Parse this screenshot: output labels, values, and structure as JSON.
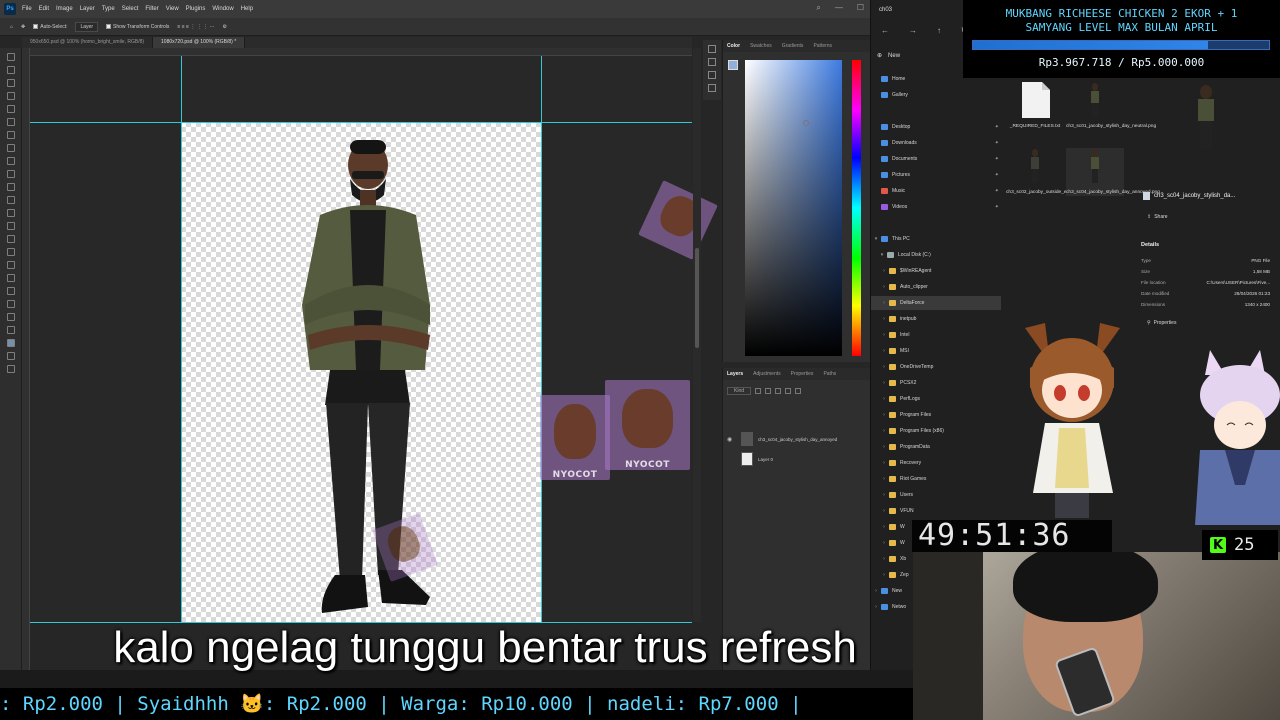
{
  "photoshop": {
    "logo": "Ps",
    "menu": [
      "File",
      "Edit",
      "Image",
      "Layer",
      "Type",
      "Select",
      "Filter",
      "View",
      "Plugins",
      "Window",
      "Help"
    ],
    "options": {
      "auto_select": "Auto-Select:",
      "layer_select": "Layer",
      "show_transform": "Show Transform Controls"
    },
    "doc_tabs": [
      {
        "label": "950x650.psd @ 100% (homo_bright_smile, RGB/8)",
        "active": false
      },
      {
        "label": "1080x720.psd @ 100% (RGB/8) *",
        "active": true
      }
    ],
    "color_panel": {
      "tabs": [
        "Color",
        "Swatches",
        "Gradients",
        "Patterns"
      ],
      "foreground": "#8fb0d8"
    },
    "layers_panel": {
      "tabs": [
        "Layers",
        "Adjustments",
        "Properties",
        "Paths"
      ],
      "filter": "Kind",
      "layers": [
        {
          "name": "ch3_sc04_jacoby_stylish_day_annoyed",
          "visible": true
        },
        {
          "name": "Layer 0",
          "visible": false
        }
      ]
    },
    "watermark_text": "NYOCOT"
  },
  "explorer": {
    "title": "ch03",
    "new_button": "New",
    "quick_access": [
      {
        "label": "Home",
        "pinned": false
      },
      {
        "label": "Gallery",
        "pinned": false
      },
      {
        "label": "Desktop",
        "pinned": true
      },
      {
        "label": "Downloads",
        "pinned": true
      },
      {
        "label": "Documents",
        "pinned": true
      },
      {
        "label": "Pictures",
        "pinned": true
      },
      {
        "label": "Music",
        "pinned": true
      },
      {
        "label": "Videos",
        "pinned": true
      }
    ],
    "this_pc": "This PC",
    "local_disk": "Local Disk (C:)",
    "folders": [
      "$WinREAgent",
      "Auto_clipper",
      "DeltaForce",
      "inetpub",
      "Intel",
      "MSI",
      "OneDriveTemp",
      "PCSX2",
      "PerfLogs",
      "Program Files",
      "Program Files (x86)",
      "ProgramData",
      "Recovery",
      "Riot Games",
      "Users",
      "VFUN",
      "W",
      "W",
      "Xb",
      "Zep"
    ],
    "network": [
      "New",
      "Netwo"
    ],
    "files": [
      {
        "name": "_REQUIRED_FILES.txt"
      },
      {
        "name": "ch3_sc01_jacoby_stylish_day_neutral.png"
      },
      {
        "name": "ch3_sc02_jacoby_outside_evening_grin.png"
      },
      {
        "name": "ch3_sc04_jacoby_stylish_day_annoyed.png"
      }
    ],
    "details": {
      "filename": "ch3_sc04_jacoby_stylish_da...",
      "share": "Share",
      "heading": "Details",
      "rows": [
        {
          "k": "Type",
          "v": "PNG File"
        },
        {
          "k": "Size",
          "v": "1,58 MB"
        },
        {
          "k": "File location",
          "v": "C:\\Users\\USER\\Pictures\\Five..."
        },
        {
          "k": "Date modified",
          "v": "28/04/2026 01:23"
        },
        {
          "k": "Dimensions",
          "v": "1340 x 2400"
        }
      ],
      "properties": "Properties"
    }
  },
  "overlay": {
    "donation_title": "MUKBANG RICHEESE CHICKEN 2 EKOR + 1\nSAMYANG LEVEL MAX BULAN APRIL",
    "donation_progress": 0.794,
    "donation_amount": "Rp3.967.718 / Rp5.000.000",
    "timer": "49:51:36",
    "kick_icon": "K",
    "viewer_count": "25",
    "subtitle": "kalo ngelag tunggu bentar trus refresh",
    "ticker": ": Rp2.000 | Syaidhhh 🐱: Rp2.000 | Warga: Rp10.000 | nadeli: Rp7.000 |"
  },
  "colors": {
    "accent_blue": "#5fd6ff",
    "guide": "#35c9d6",
    "kick_green": "#53fc18"
  }
}
